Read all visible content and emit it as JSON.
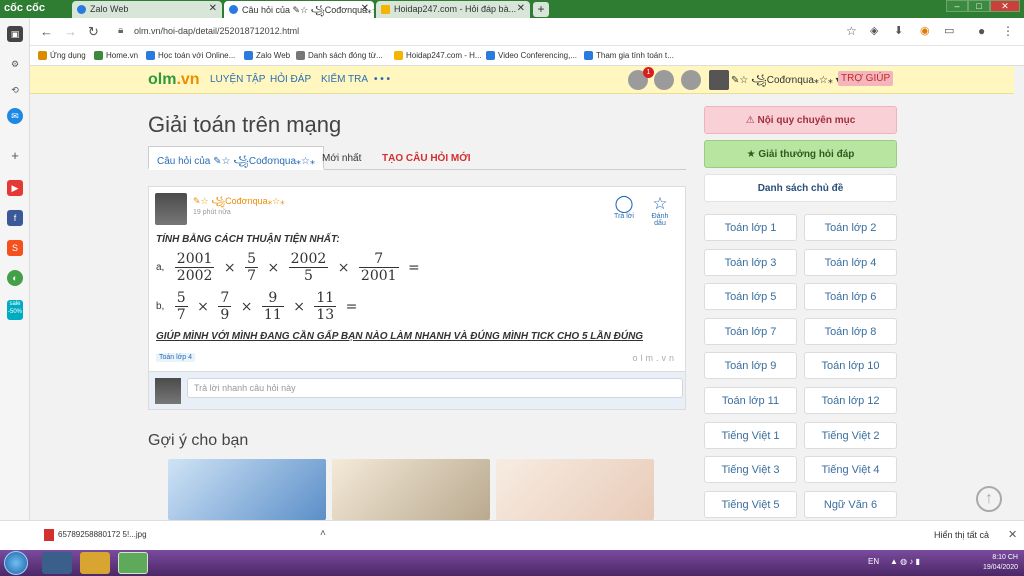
{
  "browser": {
    "brand": "cốc cốc",
    "tabs": [
      {
        "label": "Zalo Web"
      },
      {
        "label": "Câu hỏi của ✎☆ ꧁Cođơnqua⁎☆⁎"
      },
      {
        "label": "Hoidap247.com - Hỏi đáp bà..."
      }
    ],
    "new_tab": "+",
    "url": "olm.vn/hoi-dap/detail/252018712012.html",
    "bookmarks": [
      {
        "label": "Ứng dụng"
      },
      {
        "label": "Home.vn"
      },
      {
        "label": "Học toán với Online..."
      },
      {
        "label": "Zalo Web"
      },
      {
        "label": "Danh sách đóng từ..."
      },
      {
        "label": "Hoidap247.com - H..."
      },
      {
        "label": "Video Conferencing,..."
      },
      {
        "label": "Tham gia tính toán t..."
      }
    ],
    "rail_sale": "sale -50%"
  },
  "site": {
    "logo_main": "olm",
    "logo_ext": ".vn",
    "menu": [
      "LUYỆN TẬP",
      "HỎI ĐÁP",
      "KIỂM TRA",
      "• • •"
    ],
    "notif_count": "1",
    "username": "✎☆ ꧁Cođơnqua⁎☆⁎",
    "help": "TRỢ GIÚP"
  },
  "main": {
    "title": "Giải toán trên mạng",
    "tabs": [
      "Câu hỏi của ✎☆ ꧁Cođơnqua⁎☆⁎",
      "Mới nhất",
      "TẠO CÂU HỎI MỚI"
    ],
    "question": {
      "author": "✎☆ ꧁Cođơnqua⁎☆⁎",
      "time": "19 phút nữa",
      "reply_label": "Trả lời",
      "mark_label": "Đánh dấu",
      "line1": "TÍNH BẰNG CÁCH THUẬN TIỆN NHẤT:",
      "part_a_label": "a,",
      "part_b_label": "b,",
      "part_a": [
        [
          "2001",
          "2002"
        ],
        [
          "5",
          "7"
        ],
        [
          "2002",
          "5"
        ],
        [
          "7",
          "2001"
        ]
      ],
      "part_b": [
        [
          "5",
          "7"
        ],
        [
          "7",
          "9"
        ],
        [
          "9",
          "11"
        ],
        [
          "11",
          "13"
        ]
      ],
      "times": "×",
      "equals": "=",
      "line2": "GIÚP MÌNH VỚI MÌNH ĐANG CẦN GẤP BẠN NÀO LÀM NHANH VÀ ĐÚNG MÌNH TICK CHO 5 LẦN ĐÚNG",
      "tag": "Toán lớp 4",
      "watermark": "olm.vn"
    },
    "reply_placeholder": "Trả lời nhanh câu hỏi này",
    "suggest_title": "Gợi ý cho bạn"
  },
  "sidebar": {
    "rules": "Nội quy chuyên mục",
    "award": "Giải thưởng hỏi đáp",
    "topics": "Danh sách chủ đề",
    "grades": [
      "Toán lớp 1",
      "Toán lớp 2",
      "Toán lớp 3",
      "Toán lớp 4",
      "Toán lớp 5",
      "Toán lớp 6",
      "Toán lớp 7",
      "Toán lớp 8",
      "Toán lớp 9",
      "Toán lớp 10",
      "Toán lớp 11",
      "Toán lớp 12",
      "Tiếng Việt 1",
      "Tiếng Việt 2",
      "Tiếng Việt 3",
      "Tiếng Việt 4",
      "Tiếng Việt 5",
      "Ngữ Văn 6"
    ]
  },
  "downloads": {
    "file": "65789258880172 5!...jpg",
    "show_all": "Hiển thị tất cả"
  },
  "taskbar": {
    "lang": "EN",
    "time": "8:10 CH",
    "date": "19/04/2020"
  }
}
